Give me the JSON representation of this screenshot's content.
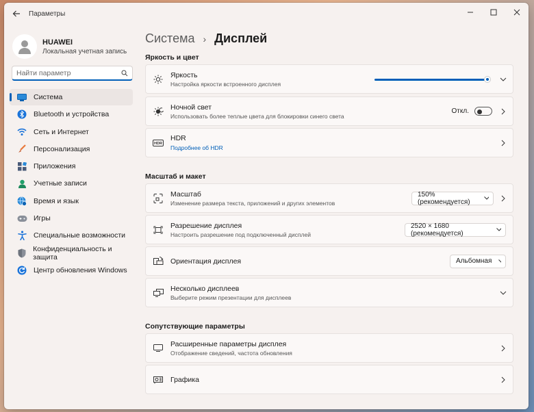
{
  "window": {
    "title": "Параметры"
  },
  "profile": {
    "name": "HUAWEI",
    "account_type": "Локальная учетная запись"
  },
  "search": {
    "placeholder": "Найти параметр"
  },
  "sidebar": {
    "items": [
      {
        "label": "Система",
        "icon": "system-icon",
        "selected": true
      },
      {
        "label": "Bluetooth и устройства",
        "icon": "bluetooth-icon"
      },
      {
        "label": "Сеть и Интернет",
        "icon": "wifi-icon"
      },
      {
        "label": "Персонализация",
        "icon": "brush-icon"
      },
      {
        "label": "Приложения",
        "icon": "apps-icon"
      },
      {
        "label": "Учетные записи",
        "icon": "person-icon"
      },
      {
        "label": "Время и язык",
        "icon": "globe-clock-icon"
      },
      {
        "label": "Игры",
        "icon": "gamepad-icon"
      },
      {
        "label": "Специальные возможности",
        "icon": "accessibility-icon"
      },
      {
        "label": "Конфиденциальность и защита",
        "icon": "shield-icon"
      },
      {
        "label": "Центр обновления Windows",
        "icon": "update-icon"
      }
    ]
  },
  "breadcrumb": {
    "parent": "Система",
    "separator": "›",
    "current": "Дисплей"
  },
  "sections": {
    "brightness_color": "Яркость и цвет",
    "scale_layout": "Масштаб и макет",
    "related": "Сопутствующие параметры"
  },
  "cards": {
    "brightness": {
      "title": "Яркость",
      "subtitle": "Настройка яркости встроенного дисплея",
      "value": 1.0
    },
    "night_light": {
      "title": "Ночной свет",
      "subtitle": "Использовать более теплые цвета для блокировки синего света",
      "state": "Откл."
    },
    "hdr": {
      "title": "HDR",
      "link": "Подробнее об HDR"
    },
    "scale": {
      "title": "Масштаб",
      "subtitle": "Изменение размера текста, приложений и других элементов",
      "value": "150% (рекомендуется)"
    },
    "resolution": {
      "title": "Разрешение дисплея",
      "subtitle": "Настроить разрешение под подключенный дисплей",
      "value": "2520 × 1680 (рекомендуется)"
    },
    "orientation": {
      "title": "Ориентация дисплея",
      "value": "Альбомная"
    },
    "multiple": {
      "title": "Несколько дисплеев",
      "subtitle": "Выберите режим презентации для дисплеев"
    },
    "advanced": {
      "title": "Расширенные параметры дисплея",
      "subtitle": "Отображение сведений, частота обновления"
    },
    "graphics": {
      "title": "Графика"
    }
  },
  "colors": {
    "accent": "#005fb8",
    "background": "#f6f1ef",
    "card": "#fbf8f7"
  }
}
